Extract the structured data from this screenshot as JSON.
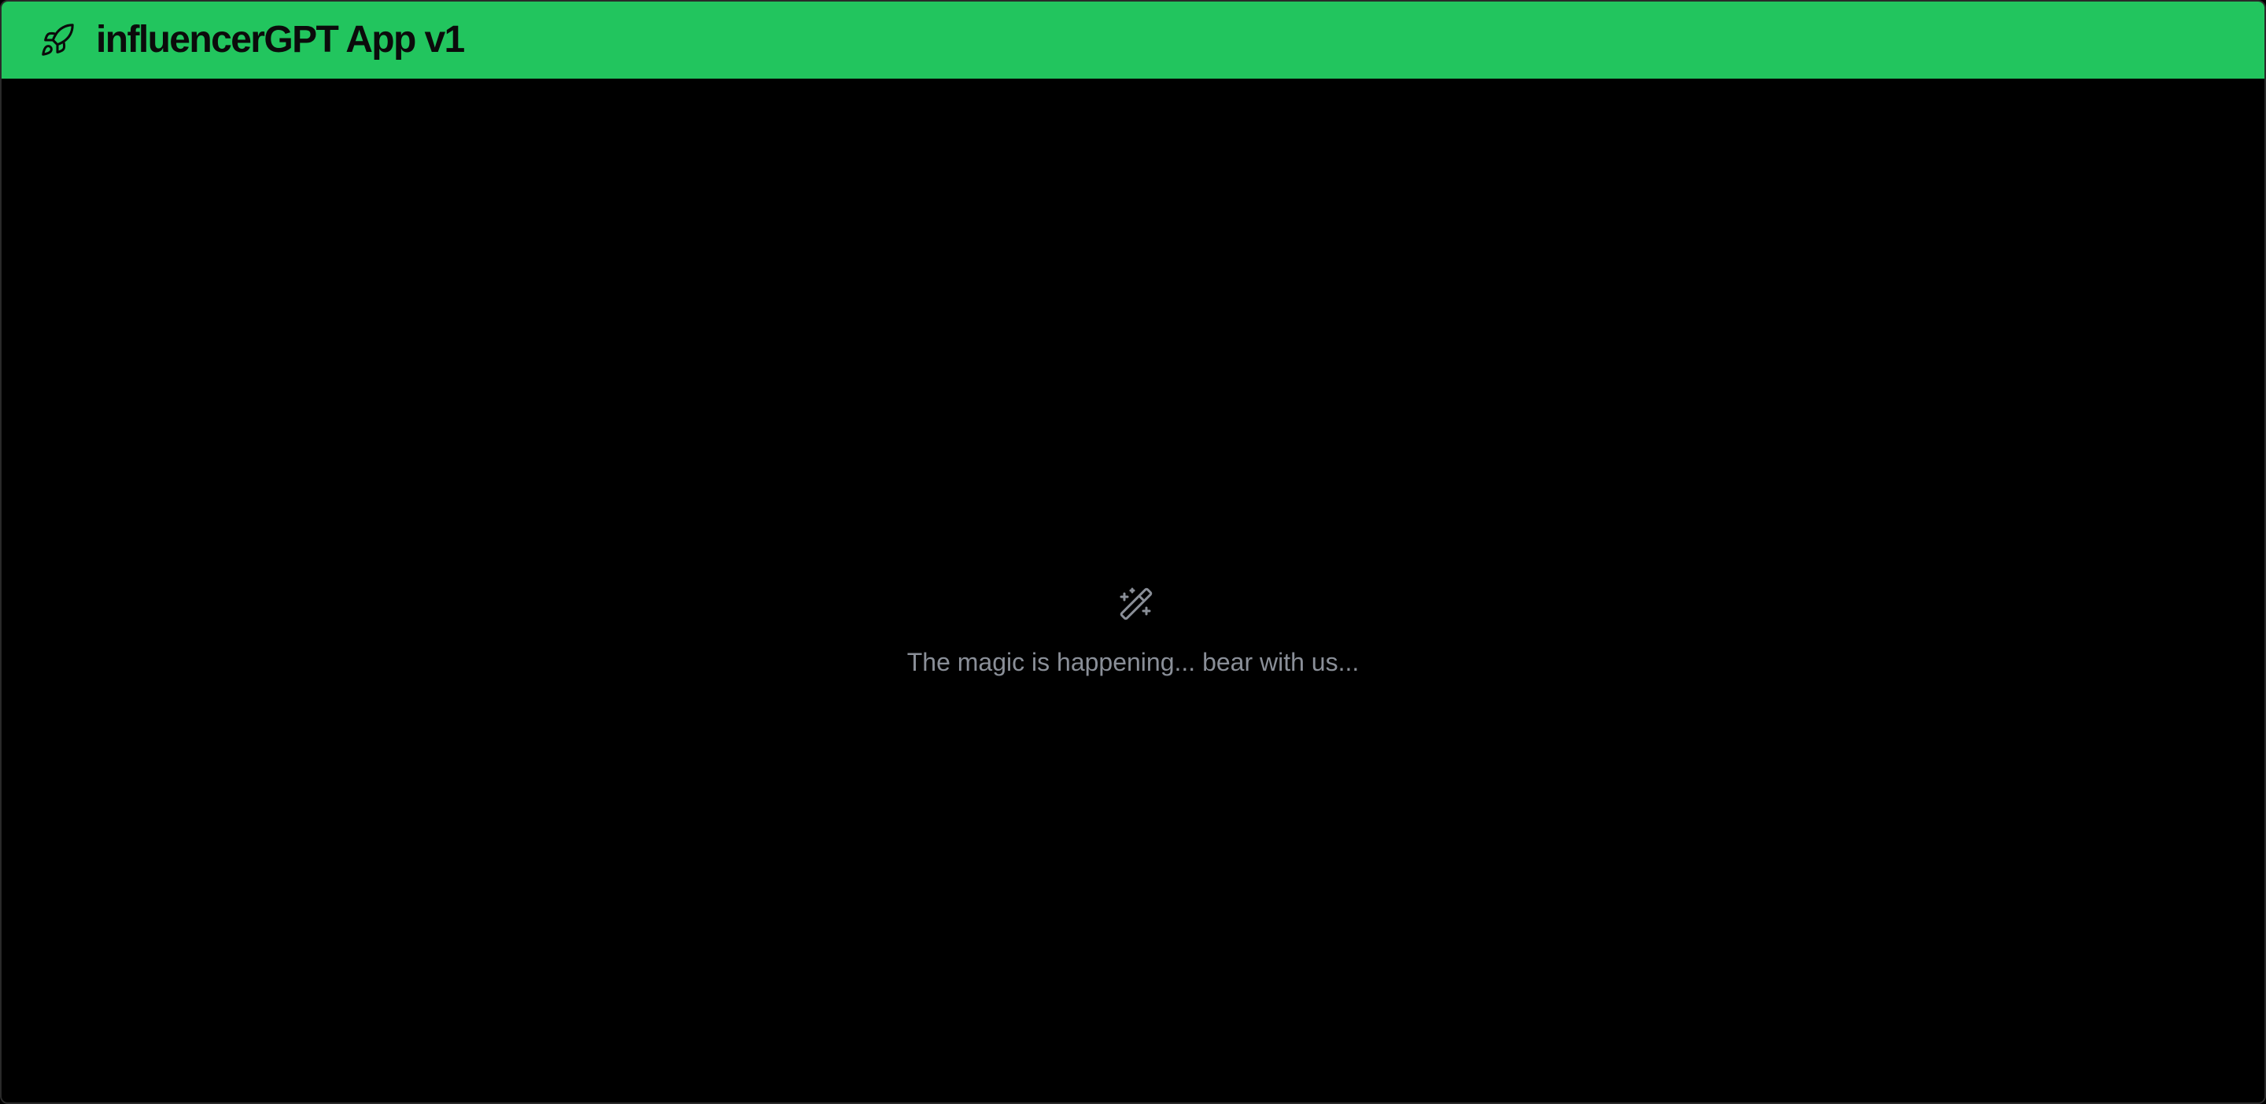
{
  "header": {
    "title": "influencerGPT App v1",
    "icon": "rocket-icon",
    "background_color": "#22c55e"
  },
  "main": {
    "background_color": "#000000",
    "loading": {
      "icon": "magic-wand-icon",
      "message": "The magic is happening... bear with us..."
    }
  }
}
